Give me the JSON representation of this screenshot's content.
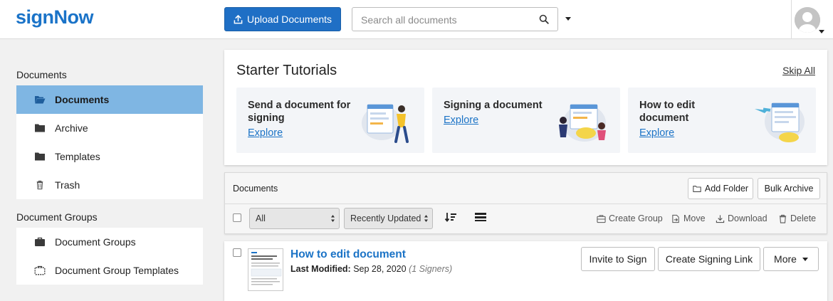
{
  "app": {
    "logo_text": "signNow"
  },
  "header": {
    "upload_label": "Upload Documents",
    "search_placeholder": "Search all documents"
  },
  "sidebar": {
    "documents_heading": "Documents",
    "documents_items": [
      {
        "label": "Documents",
        "icon": "folder-open-icon",
        "active": true
      },
      {
        "label": "Archive",
        "icon": "folder-icon",
        "active": false
      },
      {
        "label": "Templates",
        "icon": "folder-icon",
        "active": false
      },
      {
        "label": "Trash",
        "icon": "trash-icon",
        "active": false
      }
    ],
    "groups_heading": "Document Groups",
    "groups_items": [
      {
        "label": "Document Groups",
        "icon": "briefcase-icon"
      },
      {
        "label": "Document Group Templates",
        "icon": "briefcase-outline-icon"
      }
    ]
  },
  "tutorials": {
    "title": "Starter Tutorials",
    "skip_label": "Skip All",
    "items": [
      {
        "title": "Send a document for signing",
        "link": "Explore"
      },
      {
        "title": "Signing a document",
        "link": "Explore"
      },
      {
        "title": "How to edit document",
        "link": "Explore"
      }
    ]
  },
  "documents_panel": {
    "title": "Documents",
    "add_folder_label": "Add Folder",
    "bulk_archive_label": "Bulk Archive",
    "filter_value": "All",
    "sort_value": "Recently Updated",
    "actions": {
      "create_group": "Create Group",
      "move": "Move",
      "download": "Download",
      "delete": "Delete"
    }
  },
  "document_row": {
    "name": "How to edit document",
    "modified_label": "Last Modified:",
    "modified_value": "Sep 28, 2020",
    "signers": "(1 Signers)",
    "invite_label": "Invite to Sign",
    "create_link_label": "Create Signing Link",
    "more_label": "More"
  },
  "colors": {
    "brand": "#1a73c8",
    "primary_button": "#1f6fc5",
    "active_sidebar": "#7fb6e3",
    "link": "#1b73c6"
  }
}
